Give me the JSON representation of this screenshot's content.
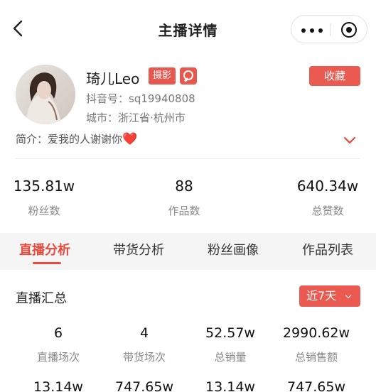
{
  "nav": {
    "title": "主播详情",
    "back_icon": "chevron-left-icon",
    "more_icon": "more-dots-icon",
    "close_icon": "target-close-icon"
  },
  "profile": {
    "name": "琦儿Leo",
    "category_tag": "摄影",
    "tag_icon": "search-icon",
    "favorite_label": "收藏",
    "douyin_id": "抖音号：sq19940808",
    "city": "城市：浙江省·杭州市",
    "intro": "简介：爱我的人谢谢你",
    "intro_emoji": "❤️",
    "expand_icon": "chevron-down-icon"
  },
  "stats": [
    {
      "value": "135.81w",
      "label": "粉丝数"
    },
    {
      "value": "88",
      "label": "作品数"
    },
    {
      "value": "640.34w",
      "label": "总赞数"
    }
  ],
  "tabs": [
    {
      "label": "直播分析",
      "active": true
    },
    {
      "label": "带货分析",
      "active": false
    },
    {
      "label": "粉丝画像",
      "active": false
    },
    {
      "label": "作品列表",
      "active": false
    }
  ],
  "summary": {
    "title": "直播汇总",
    "range": "近7天",
    "metrics_row1": [
      {
        "value": "6",
        "label": "直播场次"
      },
      {
        "value": "4",
        "label": "带货场次"
      },
      {
        "value": "52.57w",
        "label": "总销量"
      },
      {
        "value": "2990.62w",
        "label": "总销售额"
      }
    ],
    "metrics_row2": [
      {
        "value": "13.14w"
      },
      {
        "value": "747.65w"
      },
      {
        "value": "13.14w"
      },
      {
        "value": "747.65w"
      }
    ]
  },
  "colors": {
    "accent": "#eb5a50",
    "tab_active": "#e84a3e",
    "background": "#f5f5f5"
  }
}
